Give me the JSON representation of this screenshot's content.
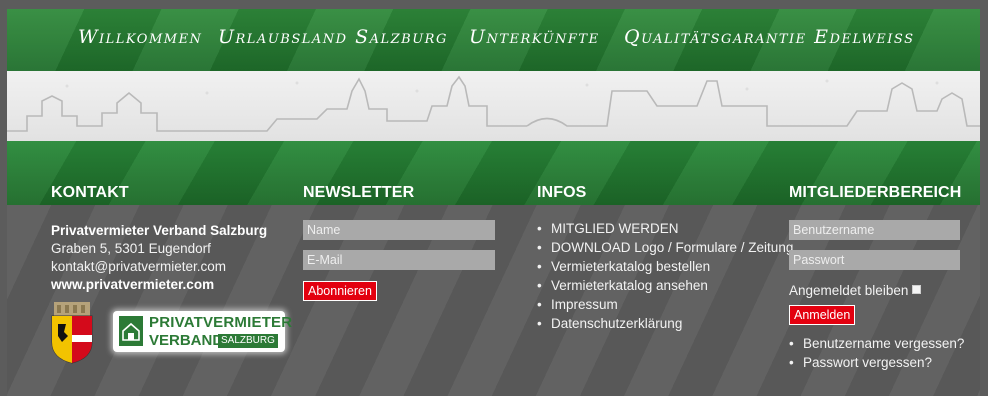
{
  "nav": {
    "items": [
      "Willkommen",
      "Urlaubsland Salzburg",
      "Unterkünfte",
      "Qualitätsgarantie Edelweiss"
    ]
  },
  "columns": {
    "kontakt": {
      "title": "KONTAKT",
      "org": "Privatvermieter Verband Salzburg",
      "address": "Graben 5, 5301 Eugendorf",
      "email": "kontakt@privatvermieter.com",
      "website": "www.privatvermieter.com",
      "logo_line1": "PRIVATVERMIETER",
      "logo_line2": "VERBAND",
      "logo_line3": "SALZBURG"
    },
    "newsletter": {
      "title": "NEWSLETTER",
      "name_placeholder": "Name",
      "email_placeholder": "E-Mail",
      "subscribe_label": "Abonnieren"
    },
    "infos": {
      "title": "INFOS",
      "links": [
        "MITGLIED WERDEN",
        "DOWNLOAD Logo / Formulare / Zeitung",
        "Vermieterkatalog bestellen",
        "Vermieterkatalog ansehen",
        "Impressum",
        "Datenschutzerklärung"
      ]
    },
    "members": {
      "title": "MITGLIEDERBEREICH",
      "username_placeholder": "Benutzername",
      "password_placeholder": "Passwort",
      "remember_label": "Angemeldet bleiben",
      "login_label": "Anmelden",
      "links": [
        "Benutzername vergessen?",
        "Passwort vergessen?"
      ]
    }
  },
  "colors": {
    "green": "#1f6e2b",
    "grey": "#5d5d5d",
    "button_red": "#e3000f",
    "input_grey": "#a9a9a9"
  }
}
